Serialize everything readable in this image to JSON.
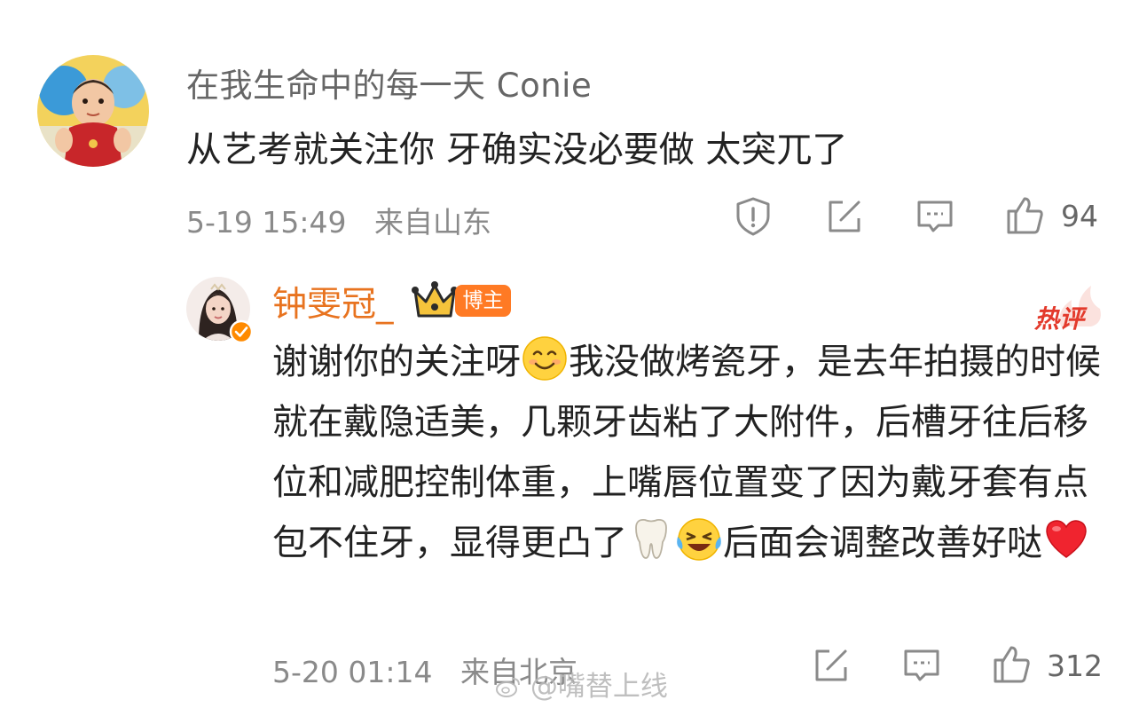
{
  "comments": [
    {
      "user_name": "在我生命中的每一天 Conie",
      "text": "从艺考就关注你  牙确实没必要做 太突兀了",
      "time": "5-19 15:49",
      "location": "来自山东",
      "like_count": "94",
      "actions": [
        "report-icon",
        "share-icon",
        "reply-icon",
        "like-icon"
      ]
    },
    {
      "user_name": "钟雯冠_",
      "badge": "博主",
      "hot_tag": "热评",
      "text_segments": [
        "谢谢你的关注呀",
        "我没做烤瓷牙，是去年拍摄的时候就在戴隐适美，几颗牙齿粘了大附件，后槽牙往后移位和减肥控制体重，上嘴唇位置变了因为戴牙套有点包不住牙，显得更凸了",
        "后面会调整改善好哒"
      ],
      "emojis": [
        "smile-emoji",
        "tooth-emoji",
        "laugh-cry-emoji",
        "heart-emoji"
      ],
      "time": "5-20 01:14",
      "location": "来自北京",
      "like_count": "312",
      "actions": [
        "share-icon",
        "reply-icon",
        "like-icon"
      ]
    }
  ],
  "watermark": "@嘴替上线",
  "colors": {
    "creator_name": "#e8731f",
    "badge_bg": "#ff7a24",
    "hot_tag": "#e33a2c",
    "meta_gray": "#8a8a8a",
    "text": "#222222"
  }
}
